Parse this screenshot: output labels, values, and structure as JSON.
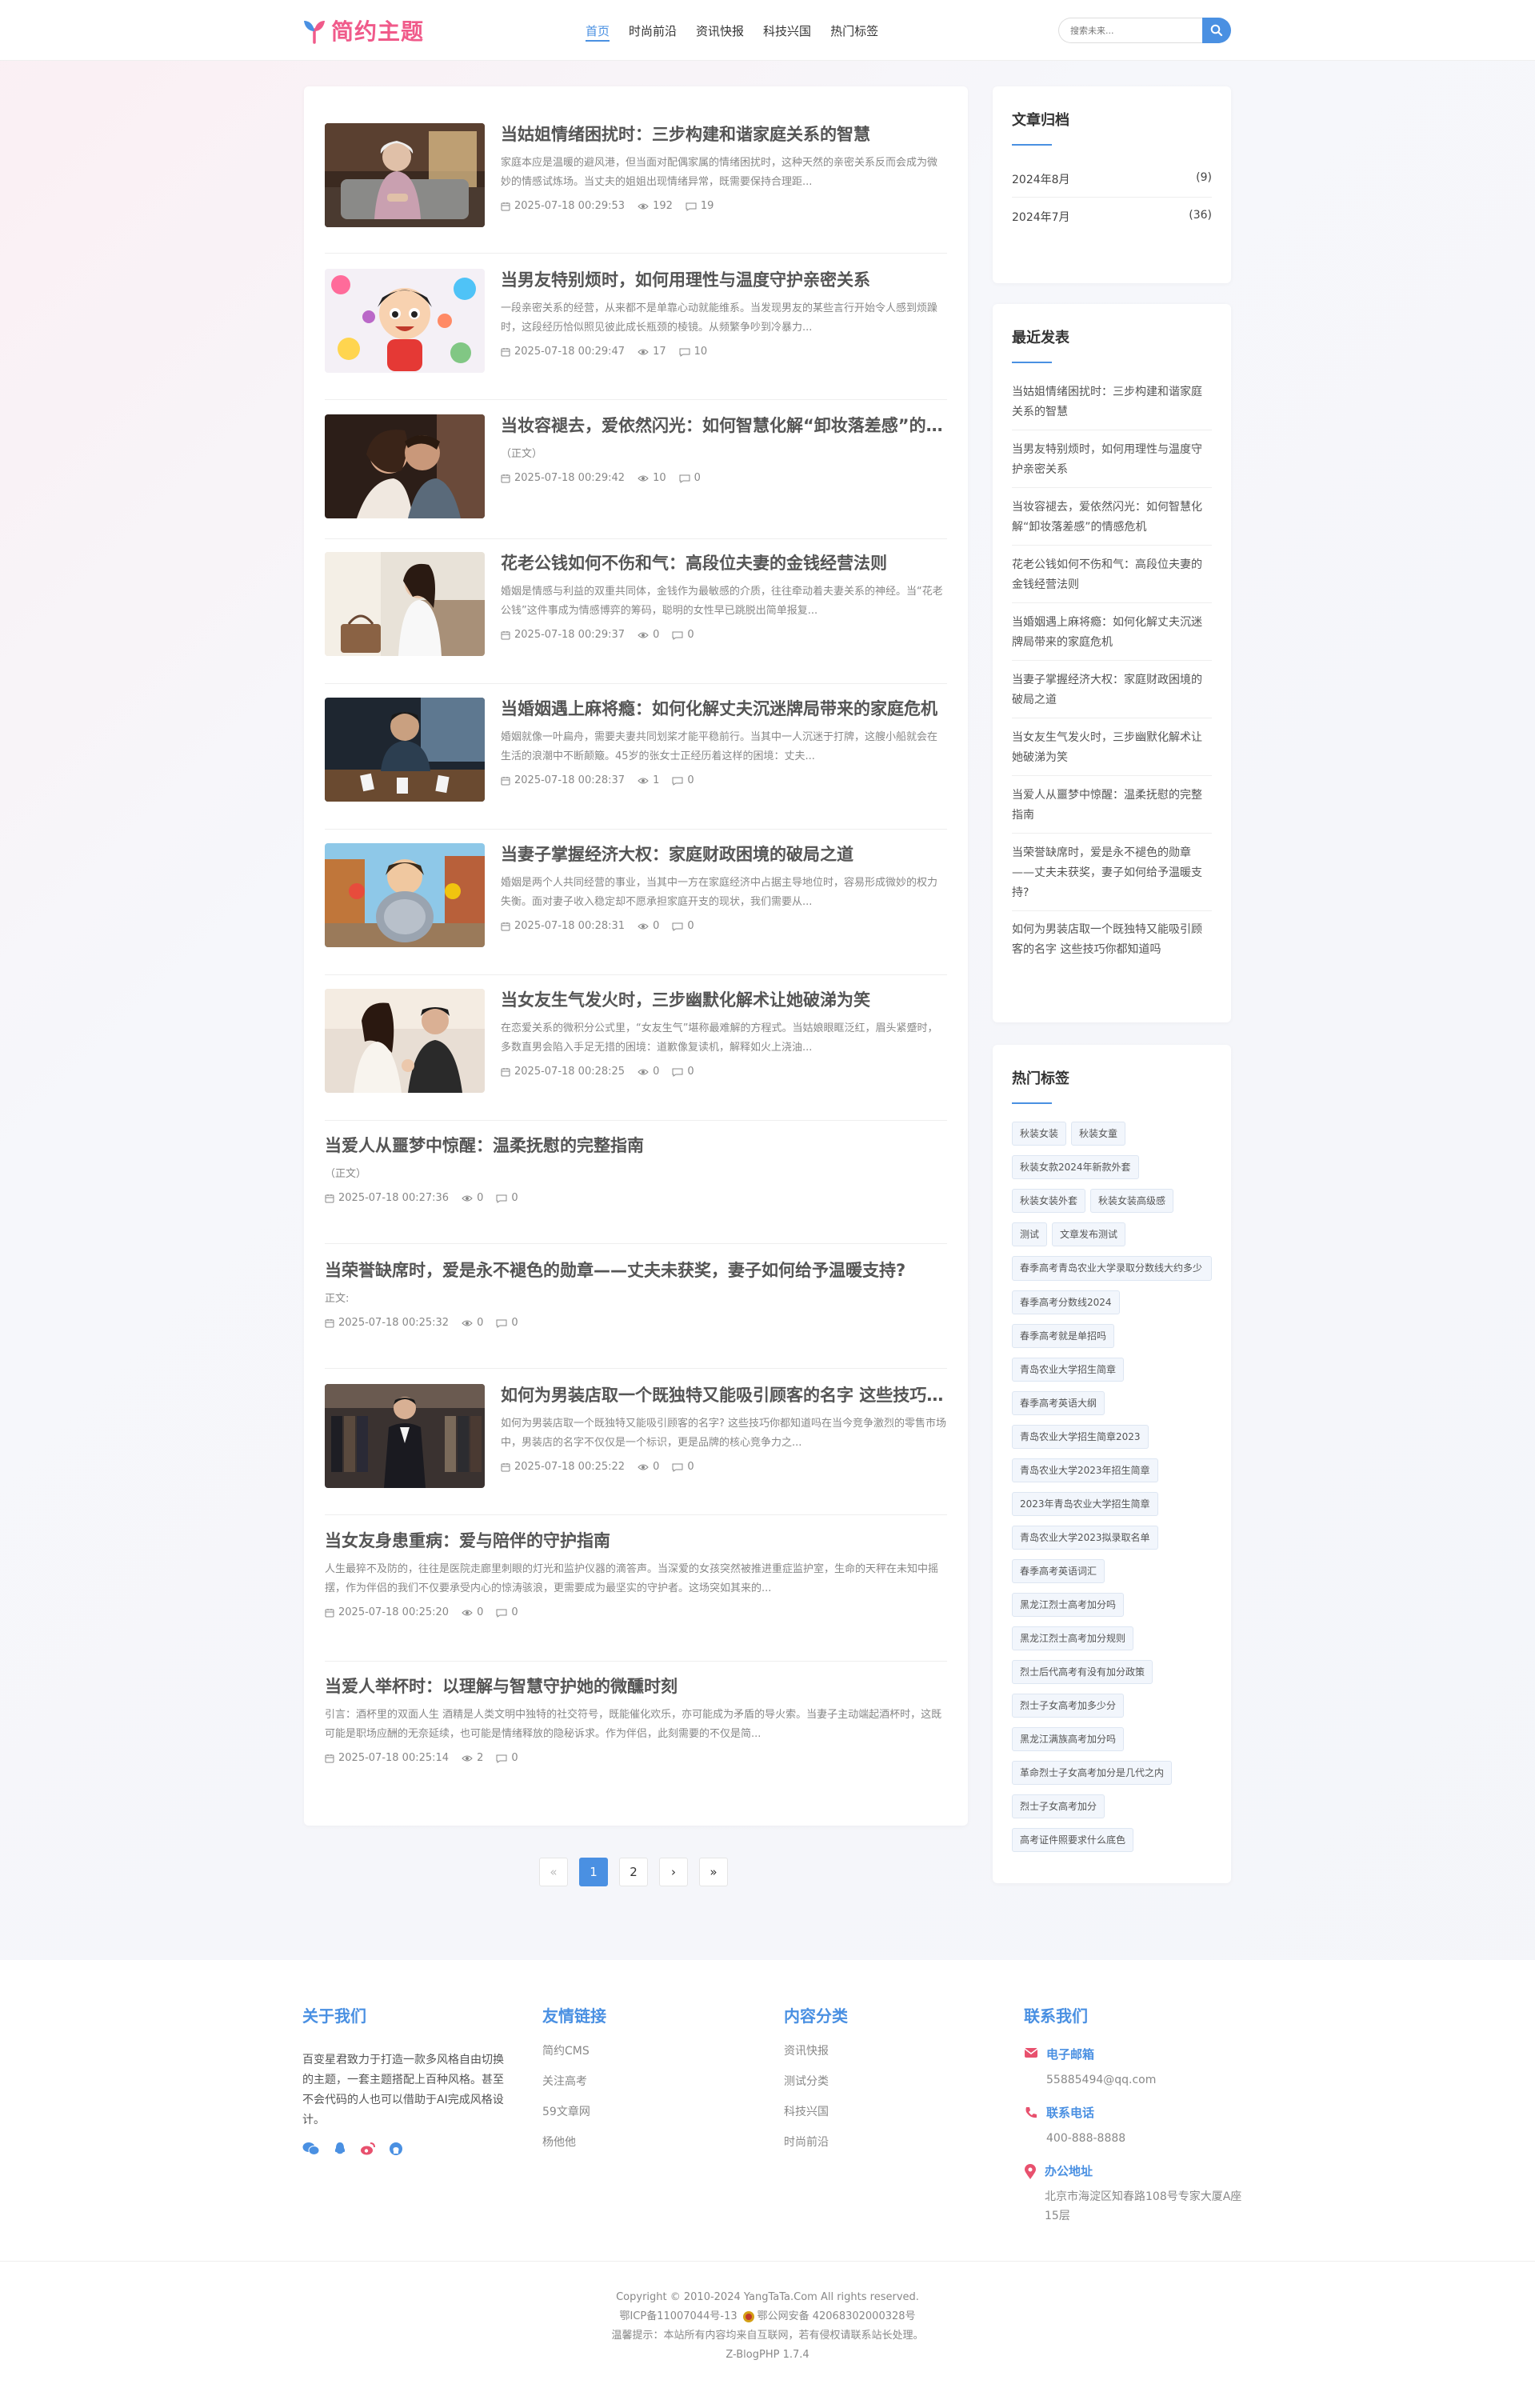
{
  "header": {
    "logo_text": "简约主题",
    "nav": [
      "首页",
      "时尚前沿",
      "资讯快报",
      "科技兴国",
      "热门标签"
    ],
    "search_placeholder": "搜索未来..."
  },
  "articles": [
    {
      "title": "当姑姐情绪困扰时：三步构建和谐家庭关系的智慧",
      "excerpt": "家庭本应是温暖的避风港，但当面对配偶家属的情绪困扰时，这种天然的亲密关系反而会成为微妙的情感试炼场。当丈夫的姐姐出现情绪异常，既需要保持合理距...",
      "date": "2025-07-18 00:29:53",
      "views": "192",
      "comments": "19",
      "image": "elderly-woman"
    },
    {
      "title": "当男友特别烦时，如何用理性与温度守护亲密关系",
      "excerpt": "一段亲密关系的经营，从来都不是单靠心动就能维系。当发现男友的某些言行开始令人感到烦躁时，这段经历恰似照见彼此成长瓶颈的棱镜。从频繁争吵到冷暴力...",
      "date": "2025-07-18 00:29:47",
      "views": "17",
      "comments": "10",
      "image": "cartoon-boy"
    },
    {
      "title": "当妆容褪去，爱依然闪光：如何智慧化解“卸妆落差感”的情感危机",
      "excerpt": "（正文）",
      "date": "2025-07-18 00:29:42",
      "views": "10",
      "comments": "0",
      "image": "couple"
    },
    {
      "title": "花老公钱如何不伤和气：高段位夫妻的金钱经营法则",
      "excerpt": "婚姻是情感与利益的双重共同体，金钱作为最敏感的介质，往往牵动着夫妻关系的神经。当“花老公钱”这件事成为情感博弈的筹码，聪明的女性早已跳脱出简单报复...",
      "date": "2025-07-18 00:29:37",
      "views": "0",
      "comments": "0",
      "image": "woman-sofa"
    },
    {
      "title": "当婚姻遇上麻将瘾：如何化解丈夫沉迷牌局带来的家庭危机",
      "excerpt": "婚姻就像一叶扁舟，需要夫妻共同划桨才能平稳前行。当其中一人沉迷于打牌，这艘小船就会在生活的浪潮中不断颠簸。45岁的张女士正经历着这样的困境：丈夫...",
      "date": "2025-07-18 00:28:37",
      "views": "1",
      "comments": "0",
      "image": "man-cards"
    },
    {
      "title": "当妻子掌握经济大权：家庭财政困境的破局之道",
      "excerpt": "婚姻是两个人共同经营的事业，当其中一方在家庭经济中占据主导地位时，容易形成微妙的权力失衡。面对妻子收入稳定却不愿承担家庭开支的现状，我们需要从...",
      "date": "2025-07-18 00:28:31",
      "views": "0",
      "comments": "0",
      "image": "cartoon-knight"
    },
    {
      "title": "当女友生气发火时，三步幽默化解术让她破涕为笑",
      "excerpt": "在恋爱关系的微积分公式里，“女友生气”堪称最难解的方程式。当姑娘眼眶泛红，眉头紧蹙时，多数直男会陷入手足无措的困境：道歉像复读机，解释如火上浇油...",
      "date": "2025-07-18 00:28:25",
      "views": "0",
      "comments": "0",
      "image": "couple-hands"
    },
    {
      "title": "当爱人从噩梦中惊醒：温柔抚慰的完整指南",
      "excerpt": "（正文）",
      "date": "2025-07-18 00:27:36",
      "views": "0",
      "comments": "0",
      "image": ""
    },
    {
      "title": "当荣誉缺席时，爱是永不褪色的勋章——丈夫未获奖，妻子如何给予温暖支持?",
      "excerpt": "正文:",
      "date": "2025-07-18 00:25:32",
      "views": "0",
      "comments": "0",
      "image": ""
    },
    {
      "title": "如何为男装店取一个既独特又能吸引顾客的名字 这些技巧你都知道吗",
      "excerpt": "如何为男装店取一个既独特又能吸引顾客的名字? 这些技巧你都知道吗在当今竞争激烈的零售市场中，男装店的名字不仅仅是一个标识，更是品牌的核心竞争力之...",
      "date": "2025-07-18 00:25:22",
      "views": "0",
      "comments": "0",
      "image": "menswear"
    },
    {
      "title": "当女友身患重病：爱与陪伴的守护指南",
      "excerpt": "人生最猝不及防的，往往是医院走廊里刺眼的灯光和监护仪器的滴答声。当深爱的女孩突然被推进重症监护室，生命的天秤在未知中摇摆，作为伴侣的我们不仅要承受内心的惊涛骇浪，更需要成为最坚实的守护者。这场突如其来的...",
      "date": "2025-07-18 00:25:20",
      "views": "0",
      "comments": "0",
      "image": ""
    },
    {
      "title": "当爱人举杯时：以理解与智慧守护她的微醺时刻",
      "excerpt": "引言：酒杯里的双面人生 酒精是人类文明中独特的社交符号，既能催化欢乐，亦可能成为矛盾的导火索。当妻子主动端起酒杯时，这既可能是职场应酬的无奈延续，也可能是情绪释放的隐秘诉求。作为伴侣，此刻需要的不仅是简...",
      "date": "2025-07-18 00:25:14",
      "views": "2",
      "comments": "0",
      "image": ""
    }
  ],
  "pagination": {
    "first": "«",
    "pages": [
      "1",
      "2"
    ],
    "next": "›",
    "last": "»"
  },
  "sidebar": {
    "archive": {
      "title": "文章归档",
      "items": [
        {
          "label": "2024年8月",
          "count": "(9)"
        },
        {
          "label": "2024年7月",
          "count": "(36)"
        }
      ]
    },
    "recent": {
      "title": "最近发表",
      "items": [
        "当姑姐情绪困扰时：三步构建和谐家庭关系的智慧",
        "当男友特别烦时，如何用理性与温度守护亲密关系",
        "当妆容褪去，爱依然闪光：如何智慧化解“卸妆落差感”的情感危机",
        "花老公钱如何不伤和气：高段位夫妻的金钱经营法则",
        "当婚姻遇上麻将瘾：如何化解丈夫沉迷牌局带来的家庭危机",
        "当妻子掌握经济大权：家庭财政困境的破局之道",
        "当女友生气发火时，三步幽默化解术让她破涕为笑",
        "当爱人从噩梦中惊醒：温柔抚慰的完整指南",
        "当荣誉缺席时，爱是永不褪色的勋章——丈夫未获奖，妻子如何给予温暖支持?",
        "如何为男装店取一个既独特又能吸引顾客的名字 这些技巧你都知道吗"
      ]
    },
    "tags": {
      "title": "热门标签",
      "items": [
        "秋装女装",
        "秋装女童",
        "秋装女款2024年新款外套",
        "秋装女装外套",
        "秋装女装高级感",
        "测试",
        "文章发布测试",
        "春季高考青岛农业大学录取分数线大约多少",
        "春季高考分数线2024",
        "春季高考就是单招吗",
        "青岛农业大学招生简章",
        "春季高考英语大纲",
        "青岛农业大学招生简章2023",
        "青岛农业大学2023年招生简章",
        "2023年青岛农业大学招生简章",
        "青岛农业大学2023拟录取名单",
        "春季高考英语词汇",
        "黑龙江烈士高考加分吗",
        "黑龙江烈士高考加分规则",
        "烈士后代高考有没有加分政策",
        "烈士子女高考加多少分",
        "黑龙江满族高考加分吗",
        "革命烈士子女高考加分是几代之内",
        "烈士子女高考加分",
        "高考证件照要求什么底色"
      ]
    }
  },
  "footer": {
    "about": {
      "title": "关于我们",
      "text": "百变星君致力于打造一款多风格自由切换的主题，一套主题搭配上百种风格。甚至不会代码的人也可以借助于AI完成风格设计。"
    },
    "friends": {
      "title": "友情链接",
      "links": [
        "简约CMS",
        "关注高考",
        "59文章网",
        "杨他他"
      ]
    },
    "categories": {
      "title": "内容分类",
      "links": [
        "资讯快报",
        "测试分类",
        "科技兴国",
        "时尚前沿"
      ]
    },
    "contact": {
      "title": "联系我们",
      "email_label": "电子邮箱",
      "email": "55885494@qq.com",
      "phone_label": "联系电话",
      "phone": "400-888-8888",
      "address_label": "办公地址",
      "address": "北京市海淀区知春路108号专家大厦A座15层"
    },
    "copyright": "Copyright © 2010-2024 YangTaTa.Com All rights reserved.",
    "icp": "鄂ICP备11007044号-13",
    "police": "鄂公网安备 42068302000328号",
    "notice": "温馨提示：本站所有内容均来自互联网，若有侵权请联系站长处理。",
    "powered": "Z-BlogPHP 1.7.4"
  },
  "colors": {
    "accent": "#4a90e2",
    "logo": "#f05a8a"
  }
}
